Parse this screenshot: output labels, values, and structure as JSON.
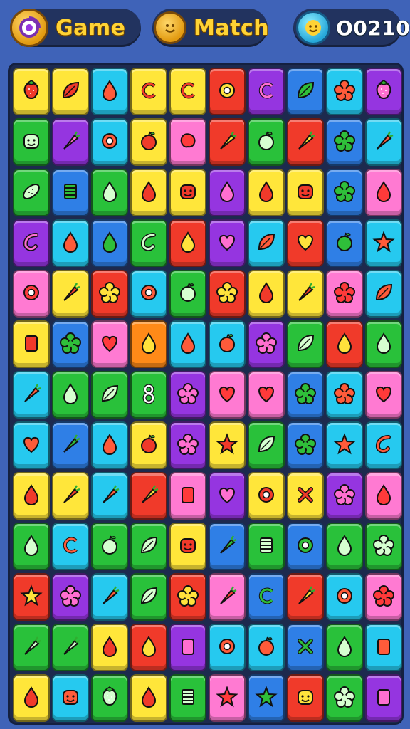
{
  "header": {
    "game_label": "Game",
    "match_label": "Match",
    "score": "O0210"
  },
  "palette": {
    "red": "#f03a2a",
    "orange": "#ff8a18",
    "yellow": "#ffe63a",
    "green": "#29c13a",
    "cyan": "#26c9ef",
    "blue": "#2f7fe6",
    "purple": "#9535e0",
    "pink": "#ff7ad2"
  },
  "board": {
    "rows": [
      [
        [
          "yellow",
          "strawberry"
        ],
        [
          "yellow",
          "leaf"
        ],
        [
          "cyan",
          "drop"
        ],
        [
          "yellow",
          "swirl"
        ],
        [
          "yellow",
          "swirl"
        ],
        [
          "red",
          "ring"
        ],
        [
          "purple",
          "swirl"
        ],
        [
          "blue",
          "leaf"
        ],
        [
          "cyan",
          "flower"
        ],
        [
          "purple",
          "strawberry"
        ]
      ],
      [
        [
          "green",
          "face"
        ],
        [
          "purple",
          "carrot"
        ],
        [
          "cyan",
          "ring"
        ],
        [
          "yellow",
          "apple"
        ],
        [
          "pink",
          "blob"
        ],
        [
          "red",
          "carrot"
        ],
        [
          "green",
          "apple"
        ],
        [
          "red",
          "carrot"
        ],
        [
          "blue",
          "flower"
        ],
        [
          "cyan",
          "carrot"
        ]
      ],
      [
        [
          "green",
          "pickle"
        ],
        [
          "blue",
          "stack"
        ],
        [
          "green",
          "drop"
        ],
        [
          "yellow",
          "drop"
        ],
        [
          "yellow",
          "face"
        ],
        [
          "purple",
          "drop"
        ],
        [
          "yellow",
          "drop"
        ],
        [
          "yellow",
          "face"
        ],
        [
          "blue",
          "flower"
        ],
        [
          "pink",
          "drop"
        ]
      ],
      [
        [
          "purple",
          "hook"
        ],
        [
          "cyan",
          "drop"
        ],
        [
          "blue",
          "drop"
        ],
        [
          "green",
          "hook"
        ],
        [
          "red",
          "drop"
        ],
        [
          "purple",
          "heart"
        ],
        [
          "cyan",
          "leaf"
        ],
        [
          "red",
          "heart"
        ],
        [
          "blue",
          "apple"
        ],
        [
          "cyan",
          "star"
        ]
      ],
      [
        [
          "pink",
          "ring"
        ],
        [
          "yellow",
          "carrot"
        ],
        [
          "red",
          "flower"
        ],
        [
          "cyan",
          "ring"
        ],
        [
          "green",
          "apple"
        ],
        [
          "red",
          "flower"
        ],
        [
          "yellow",
          "drop"
        ],
        [
          "yellow",
          "carrot"
        ],
        [
          "pink",
          "flower"
        ],
        [
          "cyan",
          "leaf"
        ]
      ],
      [
        [
          "yellow",
          "card"
        ],
        [
          "blue",
          "flower"
        ],
        [
          "pink",
          "heart"
        ],
        [
          "orange",
          "drop"
        ],
        [
          "cyan",
          "drop"
        ],
        [
          "cyan",
          "apple"
        ],
        [
          "purple",
          "flower"
        ],
        [
          "green",
          "leaf"
        ],
        [
          "red",
          "drop"
        ],
        [
          "green",
          "drop"
        ]
      ],
      [
        [
          "cyan",
          "carrot"
        ],
        [
          "green",
          "drop"
        ],
        [
          "green",
          "leaf"
        ],
        [
          "green",
          "eight"
        ],
        [
          "purple",
          "flower"
        ],
        [
          "pink",
          "heart"
        ],
        [
          "pink",
          "heart"
        ],
        [
          "blue",
          "flower"
        ],
        [
          "cyan",
          "flower"
        ],
        [
          "pink",
          "heart"
        ]
      ],
      [
        [
          "cyan",
          "heart"
        ],
        [
          "blue",
          "carrot"
        ],
        [
          "cyan",
          "drop"
        ],
        [
          "yellow",
          "apple"
        ],
        [
          "purple",
          "flower"
        ],
        [
          "yellow",
          "star"
        ],
        [
          "green",
          "leaf"
        ],
        [
          "blue",
          "flower"
        ],
        [
          "cyan",
          "star"
        ],
        [
          "cyan",
          "hook"
        ]
      ],
      [
        [
          "yellow",
          "drop"
        ],
        [
          "yellow",
          "carrot"
        ],
        [
          "cyan",
          "carrot"
        ],
        [
          "red",
          "carrot"
        ],
        [
          "pink",
          "card"
        ],
        [
          "purple",
          "heart"
        ],
        [
          "yellow",
          "ring"
        ],
        [
          "yellow",
          "x"
        ],
        [
          "purple",
          "flower"
        ],
        [
          "pink",
          "drop"
        ]
      ],
      [
        [
          "green",
          "drop"
        ],
        [
          "cyan",
          "swirl"
        ],
        [
          "green",
          "apple"
        ],
        [
          "green",
          "leaf"
        ],
        [
          "yellow",
          "face"
        ],
        [
          "blue",
          "carrot"
        ],
        [
          "green",
          "stack"
        ],
        [
          "blue",
          "ring"
        ],
        [
          "green",
          "drop"
        ],
        [
          "green",
          "flower"
        ]
      ],
      [
        [
          "red",
          "star"
        ],
        [
          "purple",
          "flower"
        ],
        [
          "cyan",
          "carrot"
        ],
        [
          "green",
          "leaf"
        ],
        [
          "red",
          "flower"
        ],
        [
          "pink",
          "carrot"
        ],
        [
          "blue",
          "swirl"
        ],
        [
          "red",
          "carrot"
        ],
        [
          "cyan",
          "ring"
        ],
        [
          "pink",
          "flower"
        ]
      ],
      [
        [
          "green",
          "carrot"
        ],
        [
          "green",
          "carrot"
        ],
        [
          "yellow",
          "drop"
        ],
        [
          "red",
          "drop"
        ],
        [
          "purple",
          "card"
        ],
        [
          "cyan",
          "ring"
        ],
        [
          "cyan",
          "apple"
        ],
        [
          "blue",
          "x"
        ],
        [
          "green",
          "drop"
        ],
        [
          "cyan",
          "card"
        ]
      ],
      [
        [
          "yellow",
          "drop"
        ],
        [
          "cyan",
          "face"
        ],
        [
          "green",
          "strawberry"
        ],
        [
          "yellow",
          "drop"
        ],
        [
          "green",
          "stack"
        ],
        [
          "pink",
          "star"
        ],
        [
          "blue",
          "star"
        ],
        [
          "red",
          "face"
        ],
        [
          "green",
          "flower"
        ],
        [
          "purple",
          "card"
        ]
      ]
    ]
  }
}
